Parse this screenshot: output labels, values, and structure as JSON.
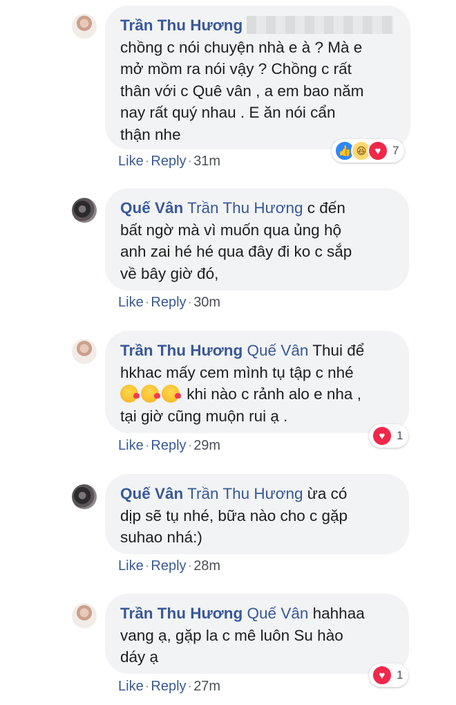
{
  "comments": [
    {
      "author": "Trần Thu Hương",
      "tag": "",
      "text_lines": [
        "chồng c nói chuyện nhà e à ? Mà e",
        "mở mồm ra nói vậy ? Chồng c rất",
        "thân với c Quê vân , a em bao năm",
        "nay rất quý nhau . E ăn nói cẩn",
        "thận nhe"
      ],
      "like": "Like",
      "reply": "Reply",
      "time": "31m",
      "reaction_count": "7"
    },
    {
      "author": "Quế Vân",
      "tag": "Trần Thu Hương",
      "first_text": "c đến",
      "text_lines": [
        "bất ngờ mà vì muốn qua ủng hộ",
        "anh zai hé hé qua đây đi ko c sắp",
        "về bây giờ đó,"
      ],
      "like": "Like",
      "reply": "Reply",
      "time": "30m"
    },
    {
      "author": "Trần Thu Hương",
      "tag": "Quế Vân",
      "first_text": "Thui để",
      "text_lines": [
        "hkhac mấy cem mình tụ tập c nhé",
        "khi nào c rảnh alo e nha ,",
        "tại giờ cũng muộn rui ạ ."
      ],
      "like": "Like",
      "reply": "Reply",
      "time": "29m",
      "reaction_count": "1"
    },
    {
      "author": "Quế Vân",
      "tag": "Trần Thu Hương",
      "first_text": "ừa có",
      "text_lines": [
        "dịp sẽ tụ nhé, bữa nào cho c gặp",
        "suhao nhá:)"
      ],
      "like": "Like",
      "reply": "Reply",
      "time": "28m"
    },
    {
      "author": "Trần Thu Hương",
      "tag": "Quế Vân",
      "first_text": "hahhaa",
      "text_lines": [
        "vang ạ, gặp la c mê luôn Su hào",
        "dáy ạ"
      ],
      "like": "Like",
      "reply": "Reply",
      "time": "27m",
      "reaction_count": "1"
    }
  ],
  "colors": {
    "name": "#385898",
    "bubble": "#f2f3f5",
    "love": "#f0284a",
    "like": "#2d88ff"
  },
  "icons": [
    "like-reaction-icon",
    "haha-reaction-icon",
    "love-reaction-icon",
    "kiss-emoji-icon"
  ]
}
